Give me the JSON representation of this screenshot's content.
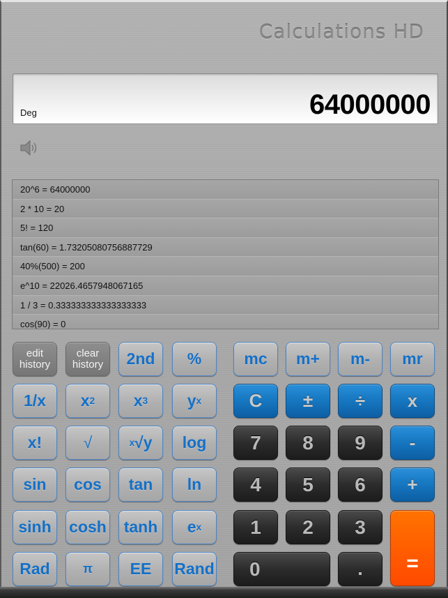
{
  "app": {
    "title": "Calculations HD"
  },
  "display": {
    "mode": "Deg",
    "value": "64000000"
  },
  "sound": {
    "icon": "speaker-icon"
  },
  "history": [
    "20^6 = 64000000",
    "2 * 10 = 20",
    "5! = 120",
    "tan(60) = 1.73205080756887729",
    "40%(500) = 200",
    "e^10 = 22026.4657948067165",
    "1 / 3 = 0.333333333333333333",
    "cos(90) = 0"
  ],
  "buttons": {
    "edit_history": "edit history",
    "clear_history": "clear history",
    "second": "2nd",
    "percent": "%",
    "reciprocal": "1/x",
    "square_base": "x",
    "square_exp": "2",
    "cube_base": "x",
    "cube_exp": "3",
    "power_base": "y",
    "power_exp": "x",
    "factorial": "x!",
    "sqrt": "√",
    "root_index": "x",
    "root_body": "√y",
    "log": "log",
    "sin": "sin",
    "cos": "cos",
    "tan": "tan",
    "ln": "ln",
    "sinh": "sinh",
    "cosh": "cosh",
    "tanh": "tanh",
    "exp_base": "e",
    "exp_exp": "x",
    "rad": "Rad",
    "pi": "π",
    "ee": "EE",
    "rand": "Rand",
    "mc": "mc",
    "mplus": "m+",
    "mminus": "m-",
    "mr": "mr",
    "clear": "C",
    "plus_minus": "±",
    "divide": "÷",
    "multiply": "x",
    "minus": "-",
    "plus": "+",
    "equals": "=",
    "decimal": ".",
    "digits": [
      "0",
      "1",
      "2",
      "3",
      "4",
      "5",
      "6",
      "7",
      "8",
      "9"
    ]
  }
}
